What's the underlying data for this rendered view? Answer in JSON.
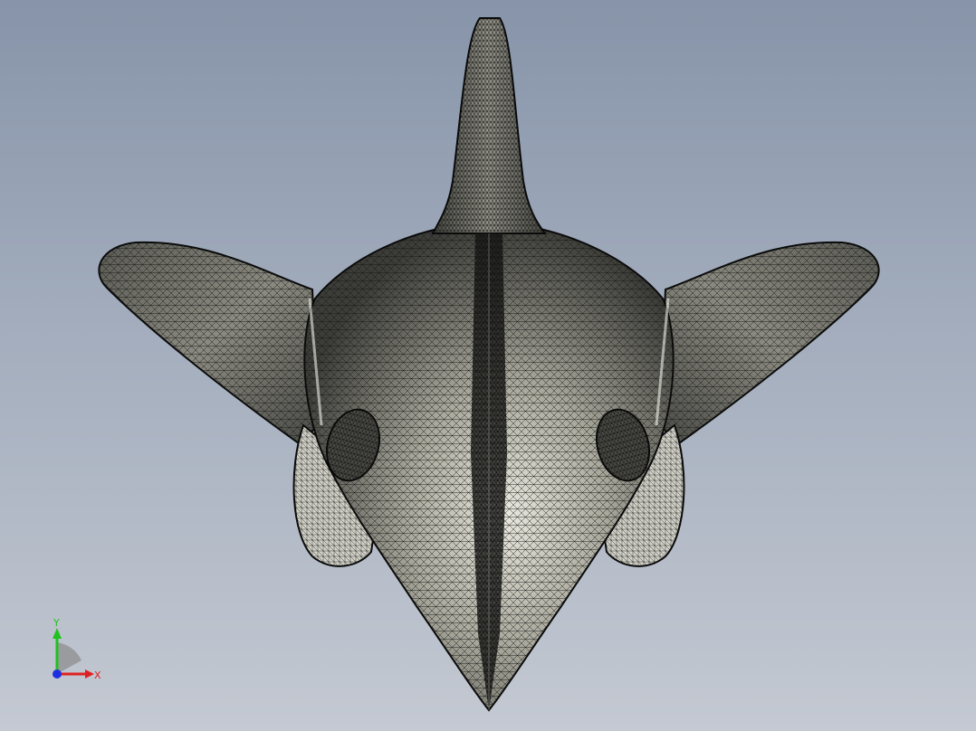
{
  "viewport": {
    "background_top": "#8794a9",
    "background_bottom": "#c4c9d2"
  },
  "model": {
    "mesh_line_color": "#111111",
    "surface_light": "#e6e6dc",
    "surface_dark": "#3a3a36"
  },
  "triad": {
    "x_label": "X",
    "y_label": "Y",
    "x_color": "#e02020",
    "y_color": "#20c020",
    "z_color": "#2030e0"
  }
}
